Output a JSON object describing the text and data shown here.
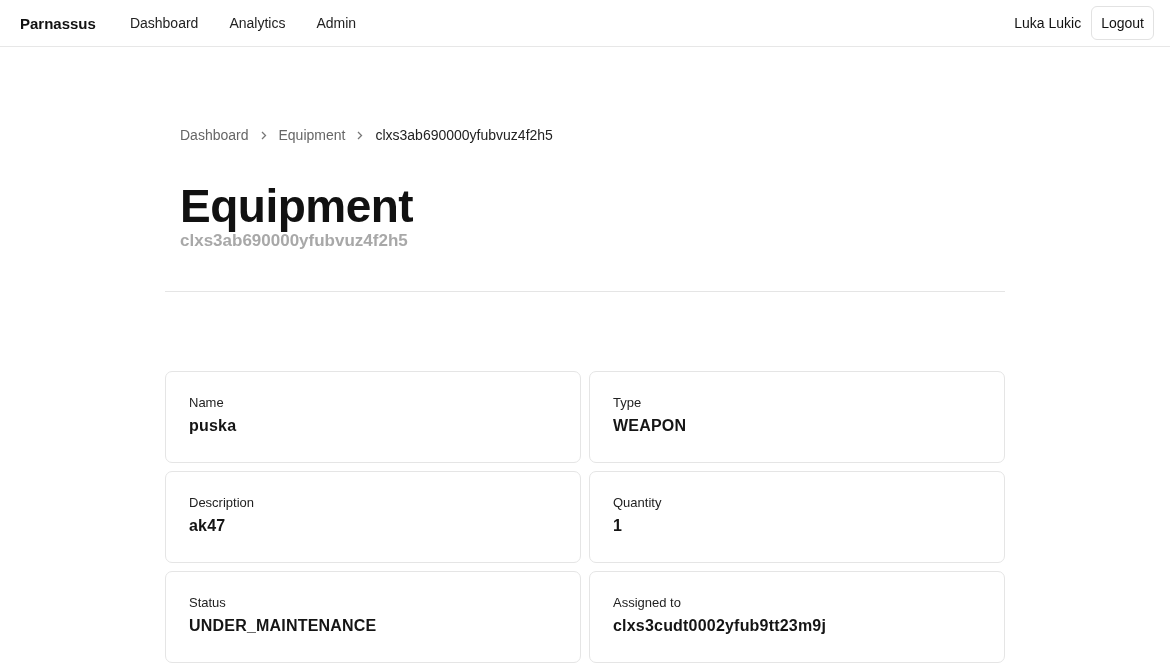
{
  "navbar": {
    "brand": "Parnassus",
    "links": [
      {
        "label": "Dashboard"
      },
      {
        "label": "Analytics"
      },
      {
        "label": "Admin"
      }
    ],
    "user": "Luka Lukic",
    "logout": "Logout"
  },
  "breadcrumb": [
    {
      "label": "Dashboard",
      "current": false
    },
    {
      "label": "Equipment",
      "current": false
    },
    {
      "label": "clxs3ab690000yfubvuz4f2h5",
      "current": true
    }
  ],
  "header": {
    "title": "Equipment",
    "subtitle": "clxs3ab690000yfubvuz4f2h5"
  },
  "fields": [
    {
      "label": "Name",
      "value": "puska"
    },
    {
      "label": "Type",
      "value": "WEAPON"
    },
    {
      "label": "Description",
      "value": "ak47"
    },
    {
      "label": "Quantity",
      "value": "1"
    },
    {
      "label": "Status",
      "value": "UNDER_MAINTENANCE"
    },
    {
      "label": "Assigned to",
      "value": "clxs3cudt0002yfub9tt23m9j"
    }
  ]
}
